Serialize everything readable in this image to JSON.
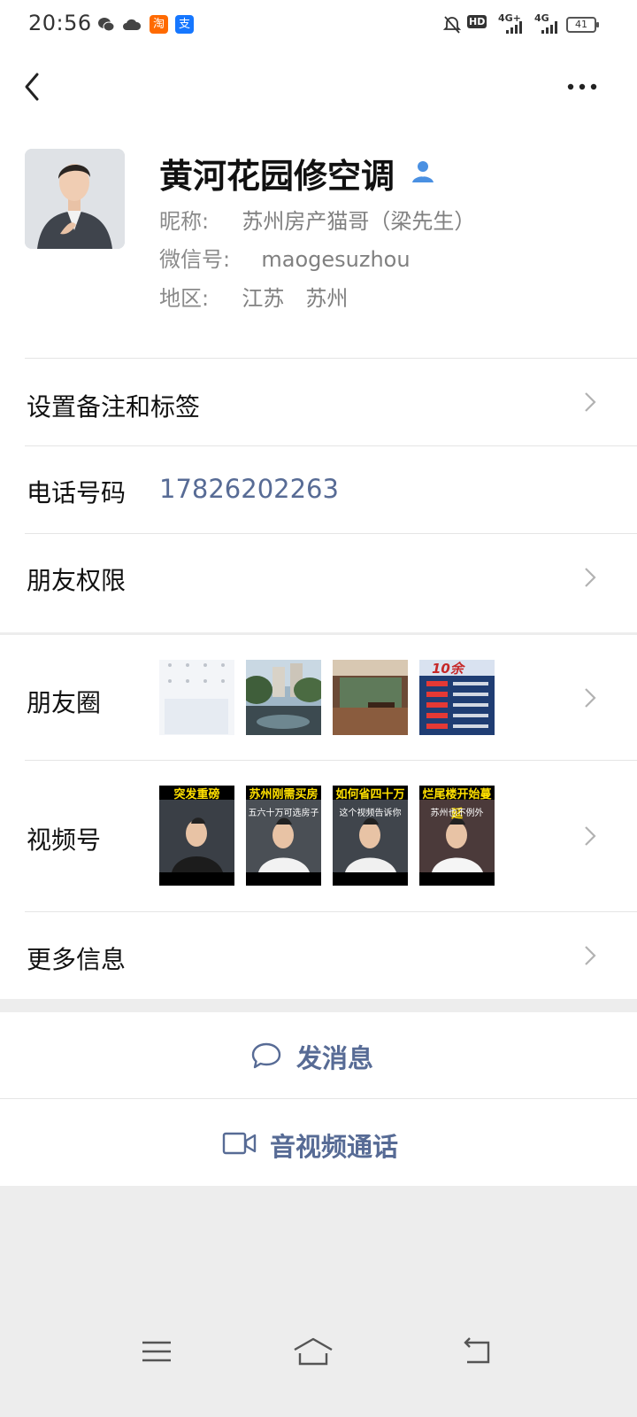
{
  "status_bar": {
    "time": "20:56",
    "icons": [
      "wechat-icon",
      "cloud-icon",
      "taobao-icon",
      "alipay-icon",
      "mute-bell-icon",
      "hd-icon",
      "signal-4g-icon",
      "signal-4g-icon",
      "battery-icon"
    ],
    "taobao_glyph": "淘",
    "alipay_glyph": "支",
    "hd_label": "HD",
    "net1": "4G+",
    "net2": "4G",
    "battery": "41"
  },
  "profile": {
    "name": "黄河花园修空调",
    "nickname_label": "昵称:",
    "nickname": "苏州房产猫哥（梁先生）",
    "wxid_label": "微信号:",
    "wxid": "maogesuzhou",
    "region_label": "地区:",
    "region": "江苏　苏州"
  },
  "rows": {
    "remark": "设置备注和标签",
    "phone_label": "电话号码",
    "phone_value": "17826202263",
    "permissions": "朋友权限",
    "moments": "朋友圈",
    "channels": "视频号",
    "more": "更多信息"
  },
  "channels_videos": [
    {
      "caption": "突发重磅",
      "subtitle": ""
    },
    {
      "caption": "苏州刚需买房",
      "subtitle": "五六十万可选房子"
    },
    {
      "caption": "如何省四十万",
      "subtitle": "这个视频告诉你"
    },
    {
      "caption": "烂尾楼开始蔓延",
      "subtitle": "苏州也不例外"
    }
  ],
  "moments_thumb_text": "10余",
  "actions": {
    "message": "发消息",
    "call": "音视频通话"
  },
  "colors": {
    "link": "#576b95",
    "background": "#ededed"
  }
}
